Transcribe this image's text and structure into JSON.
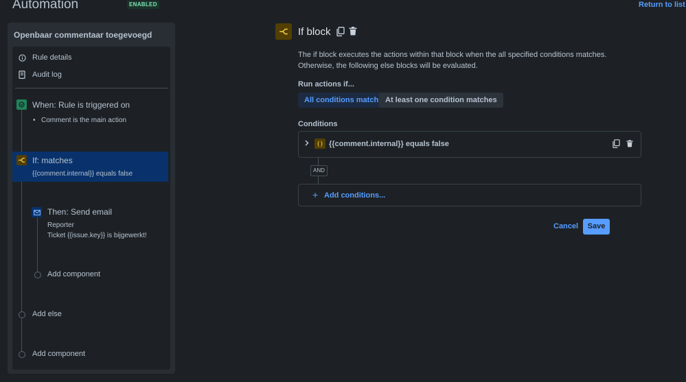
{
  "header": {
    "title": "Automation",
    "status_badge": "ENABLED",
    "return_link": "Return to list"
  },
  "sidebar": {
    "rule_name": "Openbaar commentaar toegevoegd",
    "menu": [
      {
        "label": "Rule details",
        "icon": "info-icon"
      },
      {
        "label": "Audit log",
        "icon": "document-icon"
      }
    ],
    "trigger": {
      "label": "When: Rule is triggered on",
      "bullet": "Comment is the main action",
      "icon": "trigger-icon",
      "color": "#1f845a"
    },
    "condition": {
      "label": "If: matches",
      "detail": "{{comment.internal}} equals false",
      "icon": "branch-icon",
      "color": "#a54800"
    },
    "action": {
      "label": "Then: Send email",
      "line1": "Reporter",
      "line2": "Ticket {{issue.key}} is bijgewerkt!",
      "icon": "mail-icon",
      "color": "#0055cc"
    },
    "add_component_inner": "Add component",
    "add_else": "Add else",
    "add_component_outer": "Add component"
  },
  "main": {
    "title": "If block",
    "description_line1": "The if block executes the actions within that block when the all specified conditions matches.",
    "description_line2": "Otherwise, the following else blocks will be evaluated.",
    "run_actions_label": "Run actions if...",
    "options": [
      "All conditions match",
      "At least one condition matches"
    ],
    "selected_option": "All conditions match",
    "conditions_label": "Conditions",
    "condition_text": "{{comment.internal}} equals false",
    "and_label": "AND",
    "add_conditions": "Add conditions...",
    "cancel": "Cancel",
    "save": "Save"
  },
  "colors": {
    "accent": "#579dff",
    "selected": "#09326c",
    "warning_icon_bg": "#533f04",
    "warning_icon_fg": "#f5cd47",
    "enabled_green": "#7ee2b8"
  }
}
